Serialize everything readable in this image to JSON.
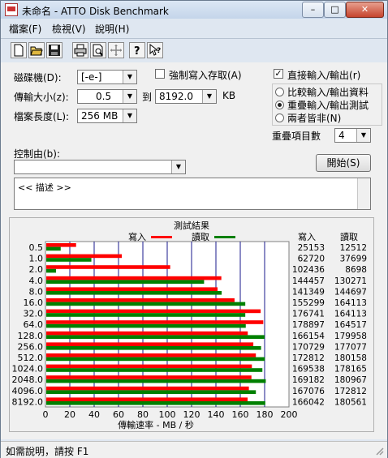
{
  "window": {
    "title": "未命名 - ATTO Disk Benchmark",
    "minimize": "–",
    "maximize": "□",
    "close": "✕"
  },
  "menu": [
    "檔案(F)",
    "檢視(V)",
    "說明(H)"
  ],
  "toolbar": [
    "new-icon",
    "open-icon",
    "save-icon",
    "print-icon",
    "print-preview-icon",
    "move-icon",
    "help-icon",
    "context-help-icon"
  ],
  "form": {
    "drive_label": "磁碟機(D):",
    "drive_value": "[-e-]",
    "transfer_label": "傳輸大小(z):",
    "transfer_from": "0.5",
    "to_label": "到",
    "transfer_to": "8192.0",
    "kb": "KB",
    "length_label": "檔案長度(L):",
    "length_value": "256 MB",
    "force_write_label": "強制寫入存取(A)",
    "force_write_checked": false,
    "direct_io_label": "直接輸入/輸出(r)",
    "direct_io_checked": true,
    "compare_label": "比較輸入/輸出資料",
    "overlap_label": "重疊輸入/輸出測試",
    "neither_label": "兩者皆非(N)",
    "queue_label": "重疊項目數",
    "queue_value": "4",
    "control_label": "控制由(b):",
    "control_value": "",
    "start_button": "開始(S)",
    "description": "<< 描述 >>"
  },
  "status": "如需說明，請按 F1",
  "chart_data": {
    "type": "bar",
    "title": "測試結果",
    "xlabel": "傳輸速率 - MB / 秒",
    "xlim": [
      0,
      200
    ],
    "xticks": [
      "0",
      "20",
      "40",
      "60",
      "80",
      "100",
      "120",
      "140",
      "160",
      "180",
      "200"
    ],
    "categories": [
      "0.5",
      "1.0",
      "2.0",
      "4.0",
      "8.0",
      "16.0",
      "32.0",
      "64.0",
      "128.0",
      "256.0",
      "512.0",
      "1024.0",
      "2048.0",
      "4096.0",
      "8192.0"
    ],
    "write_header": "寫入",
    "read_header": "讀取",
    "series": [
      {
        "name": "寫入",
        "color": "#ff0000",
        "values": [
          25153,
          62720,
          102436,
          144457,
          141349,
          155299,
          176741,
          178897,
          166154,
          170729,
          172812,
          169538,
          169182,
          167076,
          166042
        ]
      },
      {
        "name": "讀取",
        "color": "#008000",
        "values": [
          12512,
          37699,
          8698,
          130271,
          144697,
          164113,
          164113,
          164517,
          179958,
          177077,
          180158,
          178165,
          180967,
          172812,
          180561
        ]
      }
    ],
    "value_unit_divisor": 1000
  }
}
